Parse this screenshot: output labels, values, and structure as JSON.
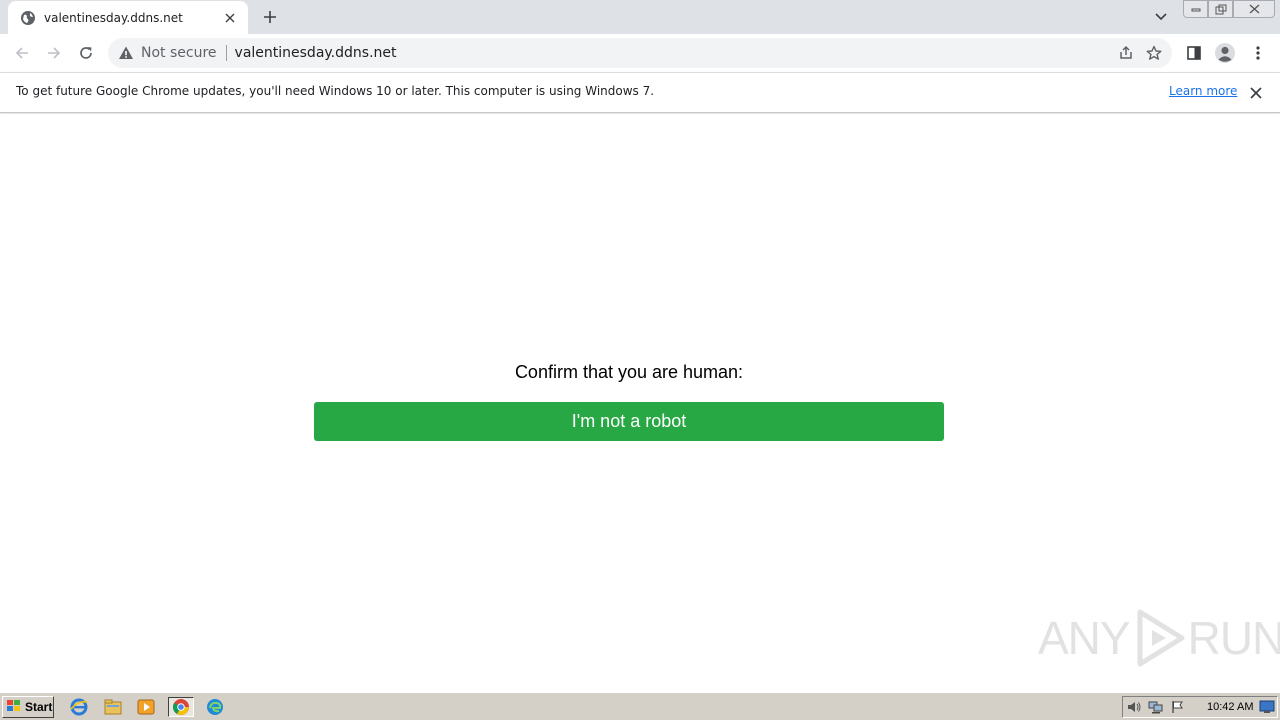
{
  "browser": {
    "tab": {
      "title": "valentinesday.ddns.net",
      "favicon": "globe-icon"
    },
    "omnibox": {
      "security_label": "Not secure",
      "url": "valentinesday.ddns.net"
    }
  },
  "infobar": {
    "message": "To get future Google Chrome updates, you'll need Windows 10 or later. This computer is using Windows 7.",
    "link_label": "Learn more"
  },
  "page": {
    "prompt": "Confirm that you are human:",
    "button_label": "I'm not a robot",
    "button_color": "#28a745",
    "watermark_left": "ANY",
    "watermark_right": "RUN"
  },
  "taskbar": {
    "start_label": "Start",
    "clock": "10:42 AM"
  }
}
